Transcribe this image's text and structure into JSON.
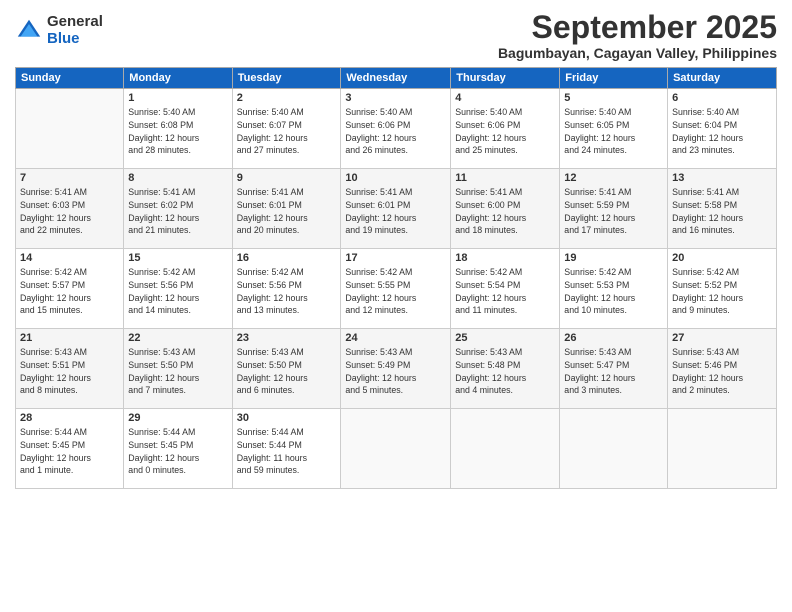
{
  "logo": {
    "text_general": "General",
    "text_blue": "Blue"
  },
  "title": "September 2025",
  "location": "Bagumbayan, Cagayan Valley, Philippines",
  "weekdays": [
    "Sunday",
    "Monday",
    "Tuesday",
    "Wednesday",
    "Thursday",
    "Friday",
    "Saturday"
  ],
  "weeks": [
    [
      {
        "day": "",
        "info": ""
      },
      {
        "day": "1",
        "info": "Sunrise: 5:40 AM\nSunset: 6:08 PM\nDaylight: 12 hours\nand 28 minutes."
      },
      {
        "day": "2",
        "info": "Sunrise: 5:40 AM\nSunset: 6:07 PM\nDaylight: 12 hours\nand 27 minutes."
      },
      {
        "day": "3",
        "info": "Sunrise: 5:40 AM\nSunset: 6:06 PM\nDaylight: 12 hours\nand 26 minutes."
      },
      {
        "day": "4",
        "info": "Sunrise: 5:40 AM\nSunset: 6:06 PM\nDaylight: 12 hours\nand 25 minutes."
      },
      {
        "day": "5",
        "info": "Sunrise: 5:40 AM\nSunset: 6:05 PM\nDaylight: 12 hours\nand 24 minutes."
      },
      {
        "day": "6",
        "info": "Sunrise: 5:40 AM\nSunset: 6:04 PM\nDaylight: 12 hours\nand 23 minutes."
      }
    ],
    [
      {
        "day": "7",
        "info": "Sunrise: 5:41 AM\nSunset: 6:03 PM\nDaylight: 12 hours\nand 22 minutes."
      },
      {
        "day": "8",
        "info": "Sunrise: 5:41 AM\nSunset: 6:02 PM\nDaylight: 12 hours\nand 21 minutes."
      },
      {
        "day": "9",
        "info": "Sunrise: 5:41 AM\nSunset: 6:01 PM\nDaylight: 12 hours\nand 20 minutes."
      },
      {
        "day": "10",
        "info": "Sunrise: 5:41 AM\nSunset: 6:01 PM\nDaylight: 12 hours\nand 19 minutes."
      },
      {
        "day": "11",
        "info": "Sunrise: 5:41 AM\nSunset: 6:00 PM\nDaylight: 12 hours\nand 18 minutes."
      },
      {
        "day": "12",
        "info": "Sunrise: 5:41 AM\nSunset: 5:59 PM\nDaylight: 12 hours\nand 17 minutes."
      },
      {
        "day": "13",
        "info": "Sunrise: 5:41 AM\nSunset: 5:58 PM\nDaylight: 12 hours\nand 16 minutes."
      }
    ],
    [
      {
        "day": "14",
        "info": "Sunrise: 5:42 AM\nSunset: 5:57 PM\nDaylight: 12 hours\nand 15 minutes."
      },
      {
        "day": "15",
        "info": "Sunrise: 5:42 AM\nSunset: 5:56 PM\nDaylight: 12 hours\nand 14 minutes."
      },
      {
        "day": "16",
        "info": "Sunrise: 5:42 AM\nSunset: 5:56 PM\nDaylight: 12 hours\nand 13 minutes."
      },
      {
        "day": "17",
        "info": "Sunrise: 5:42 AM\nSunset: 5:55 PM\nDaylight: 12 hours\nand 12 minutes."
      },
      {
        "day": "18",
        "info": "Sunrise: 5:42 AM\nSunset: 5:54 PM\nDaylight: 12 hours\nand 11 minutes."
      },
      {
        "day": "19",
        "info": "Sunrise: 5:42 AM\nSunset: 5:53 PM\nDaylight: 12 hours\nand 10 minutes."
      },
      {
        "day": "20",
        "info": "Sunrise: 5:42 AM\nSunset: 5:52 PM\nDaylight: 12 hours\nand 9 minutes."
      }
    ],
    [
      {
        "day": "21",
        "info": "Sunrise: 5:43 AM\nSunset: 5:51 PM\nDaylight: 12 hours\nand 8 minutes."
      },
      {
        "day": "22",
        "info": "Sunrise: 5:43 AM\nSunset: 5:50 PM\nDaylight: 12 hours\nand 7 minutes."
      },
      {
        "day": "23",
        "info": "Sunrise: 5:43 AM\nSunset: 5:50 PM\nDaylight: 12 hours\nand 6 minutes."
      },
      {
        "day": "24",
        "info": "Sunrise: 5:43 AM\nSunset: 5:49 PM\nDaylight: 12 hours\nand 5 minutes."
      },
      {
        "day": "25",
        "info": "Sunrise: 5:43 AM\nSunset: 5:48 PM\nDaylight: 12 hours\nand 4 minutes."
      },
      {
        "day": "26",
        "info": "Sunrise: 5:43 AM\nSunset: 5:47 PM\nDaylight: 12 hours\nand 3 minutes."
      },
      {
        "day": "27",
        "info": "Sunrise: 5:43 AM\nSunset: 5:46 PM\nDaylight: 12 hours\nand 2 minutes."
      }
    ],
    [
      {
        "day": "28",
        "info": "Sunrise: 5:44 AM\nSunset: 5:45 PM\nDaylight: 12 hours\nand 1 minute."
      },
      {
        "day": "29",
        "info": "Sunrise: 5:44 AM\nSunset: 5:45 PM\nDaylight: 12 hours\nand 0 minutes."
      },
      {
        "day": "30",
        "info": "Sunrise: 5:44 AM\nSunset: 5:44 PM\nDaylight: 11 hours\nand 59 minutes."
      },
      {
        "day": "",
        "info": ""
      },
      {
        "day": "",
        "info": ""
      },
      {
        "day": "",
        "info": ""
      },
      {
        "day": "",
        "info": ""
      }
    ]
  ]
}
